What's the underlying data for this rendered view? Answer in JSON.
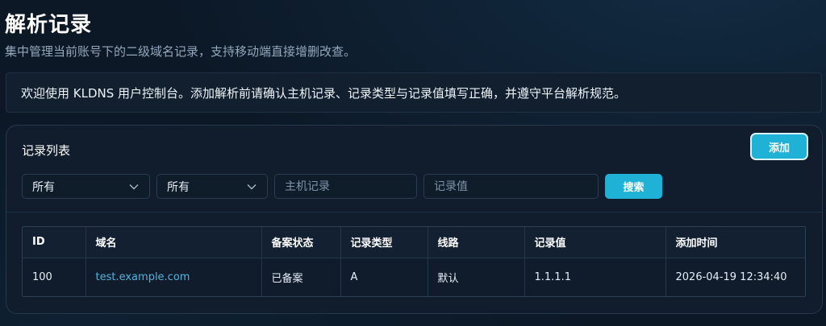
{
  "page": {
    "title": "解析记录",
    "subtitle": "集中管理当前账号下的二级域名记录，支持移动端直接增删改查。"
  },
  "notice": {
    "text": "欢迎使用 KLDNS 用户控制台。添加解析前请确认主机记录、记录类型与记录值填写正确，并遵守平台解析规范。"
  },
  "panel": {
    "title": "记录列表",
    "add_label": "添加"
  },
  "filters": {
    "domain_select": "所有",
    "type_select": "所有",
    "host_placeholder": "主机记录",
    "value_placeholder": "记录值",
    "search_label": "搜索"
  },
  "table": {
    "headers": [
      "ID",
      "域名",
      "备案状态",
      "记录类型",
      "线路",
      "记录值",
      "添加时间"
    ],
    "rows": [
      [
        "100",
        "test.example.com",
        "已备案",
        "A",
        "默认",
        "1.1.1.1",
        "2026-04-19 12:34:40"
      ]
    ]
  },
  "icons": {
    "select_arrow": "chevron-down-icon"
  },
  "colors": {
    "accent": "#1fb2d6",
    "link": "#4fb3db",
    "background": "#0c1826"
  }
}
